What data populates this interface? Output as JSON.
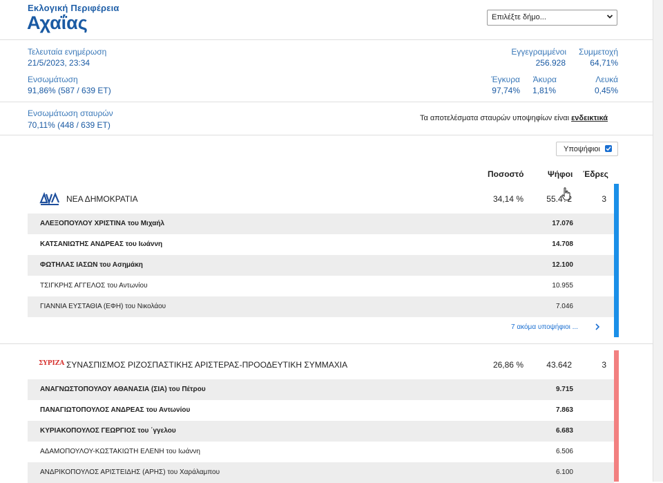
{
  "header": {
    "region_label": "Εκλογική Περιφέρεια",
    "region_name": "Αχαΐας",
    "municipality_select": {
      "value": "Επιλέξτε δήμο...",
      "icon": "chevron-down-icon"
    }
  },
  "stats": {
    "last_update_label": "Τελευταία ενημέρωση",
    "last_update_value": "21/5/2023, 23:34",
    "integration_label": "Ενσωμάτωση",
    "integration_value": "91,86% (587 / 639 ΕΤ)",
    "registered_label": "Εγγεγραμμένοι",
    "registered_value": "256.928",
    "turnout_label": "Συμμετοχή",
    "turnout_value": "64,71%",
    "valid_label": "Έγκυρα",
    "valid_value": "97,74%",
    "invalid_label": "Άκυρα",
    "invalid_value": "1,81%",
    "blank_label": "Λευκά",
    "blank_value": "0,45%"
  },
  "preference": {
    "label": "Ενσωμάτωση σταυρών",
    "value": "70,11% (448 / 639 ΕΤ)",
    "note_text": "Τα αποτελέσματα σταυρών υποψηφίων είναι ",
    "note_link": "ενδεικτικά"
  },
  "controls": {
    "candidates_toggle_label": "Υποψήφιοι",
    "candidates_toggle_checked": true
  },
  "columns": {
    "percent": "Ποσοστό",
    "votes": "Ψήφοι",
    "seats": "Έδρες"
  },
  "parties": [
    {
      "name": "ΝΕΑ ΔΗΜΟΚΡΑΤΙΑ",
      "logo": "nd-logo",
      "percent": "34,14 %",
      "votes": "55.4?2",
      "seats": "3",
      "color": "#1a8fe8",
      "candidates": [
        {
          "name": "ΑΛΕΞΟΠΟΥΛΟΥ ΧΡΙΣΤΙΝΑ του Μιχαήλ",
          "votes": "17.076",
          "elected": true
        },
        {
          "name": "ΚΑΤΣΑΝΙΩΤΗΣ ΑΝΔΡΕΑΣ του Ιωάννη",
          "votes": "14.708",
          "elected": true
        },
        {
          "name": "ΦΩΤΗΛΑΣ ΙΑΣΩΝ του Ασημάκη",
          "votes": "12.100",
          "elected": true
        },
        {
          "name": "ΤΣΙΓΚΡΗΣ ΑΓΓΕΛΟΣ του Αντωνίου",
          "votes": "10.955",
          "elected": false
        },
        {
          "name": "ΓΙΑΝΝΙΑ ΕΥΣΤΑΘΙΑ (ΕΦΗ) του Νικολάου",
          "votes": "7.046",
          "elected": false
        }
      ],
      "more_label": "7 ακόμα υποψήφιοι ..."
    },
    {
      "name": "ΣΥΝΑΣΠΙΣΜΟΣ ΡΙΖΟΣΠΑΣΤΙΚΗΣ ΑΡΙΣΤΕΡΑΣ-ΠΡΟΟΔΕΥΤΙΚΗ ΣΥΜΜΑΧΙΑ",
      "logo": "syriza-logo",
      "logo_text": "ΣΥΡΙΖΑ",
      "percent": "26,86 %",
      "votes": "43.642",
      "seats": "3",
      "color": "#f28080",
      "candidates": [
        {
          "name": "ΑΝΑΓΝΩΣΤΟΠΟΥΛΟΥ ΑΘΑΝΑΣΙΑ (ΣΙΑ) του Πέτρου",
          "votes": "9.715",
          "elected": true
        },
        {
          "name": "ΠΑΝΑΓΙΩΤΟΠΟΥΛΟΣ ΑΝΔΡΕΑΣ του Αντωνίου",
          "votes": "7.863",
          "elected": true
        },
        {
          "name": "ΚΥΡΙΑΚΟΠΟΥΛΟΣ ΓΕΩΡΓΙΟΣ του ΄γγελου",
          "votes": "6.683",
          "elected": true
        },
        {
          "name": "ΑΔΑΜΟΠΟΥΛΟΥ-ΚΩΣΤΑΚΙΩΤΗ ΕΛΕΝΗ του Ιωάννη",
          "votes": "6.506",
          "elected": false
        },
        {
          "name": "ΑΝΔΡΙΚΟΠΟΥΛΟΣ ΑΡΙΣΤΕΙΔΗΣ (ΑΡΗΣ) του Χαράλαμπου",
          "votes": "6.100",
          "elected": false
        }
      ]
    }
  ]
}
